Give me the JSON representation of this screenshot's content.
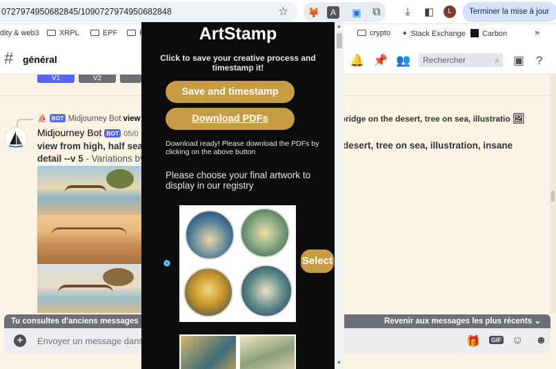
{
  "browser": {
    "url": "0727974950682845/1090727974950682848",
    "update_label": "Terminer la mise à jour",
    "profile_initial": "L",
    "bookmarks": [
      "dity & web3",
      "XRPL",
      "EPF",
      "F",
      "crypto",
      "Stack Exchange",
      "Carbon"
    ]
  },
  "discord": {
    "channel": "général",
    "search_placeholder": "Rechercher",
    "variation_buttons": [
      "V1",
      "V2",
      ""
    ],
    "reply": {
      "author": "Midjourney Bot",
      "badge": "BOT",
      "snippet": "view",
      "snippet_right": "t, bridge on the desert, tree on sea, illustratio"
    },
    "message": {
      "author": "Midjourney Bot",
      "badge": "BOT",
      "date": "05/0",
      "text_line1": "view from high, half sea h",
      "text_line2_bold": "detail --v 5",
      "text_line2_rest": " - Variations by",
      "text_right": "desert, tree on sea, illustration, insane"
    },
    "old_messages_label": "Tu consultes d'anciens messages",
    "jump_label": "Revenir aux messages les plus récents",
    "composer_placeholder": "Envoyer un message dans #",
    "gif_label": "GIF"
  },
  "popup": {
    "title": "ArtStamp",
    "subtitle": "Click to save your creative process and timestamp it!",
    "save_button": "Save and timestamp",
    "download_button": "Download PDFs",
    "download_note": "Download ready! Please download the PDFs by clicking on the above button",
    "choose_text": "Please choose your final artwork to display in our registry",
    "select_button": "Select"
  }
}
